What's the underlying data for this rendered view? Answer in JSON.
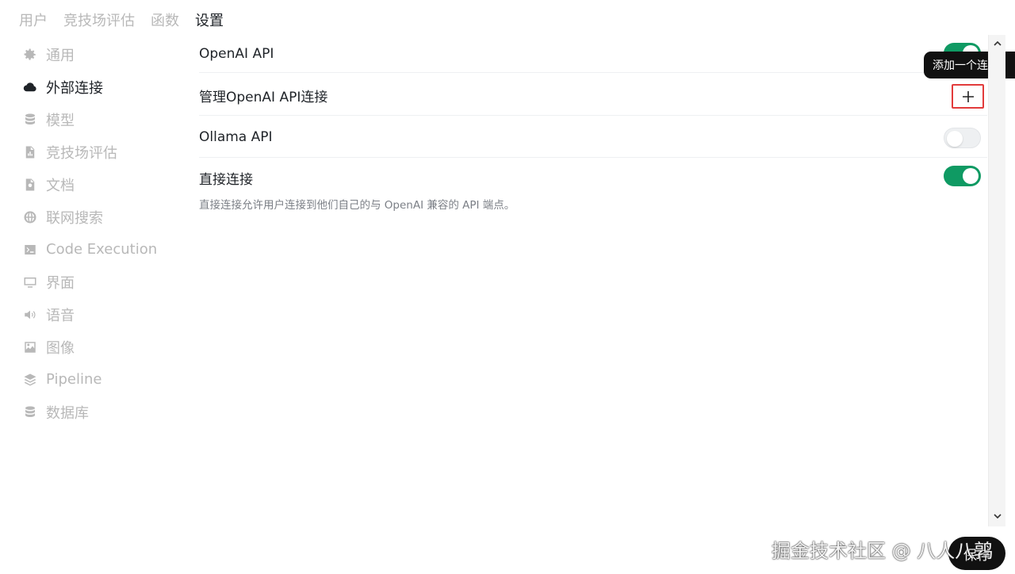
{
  "top_tabs": [
    {
      "label": "用户"
    },
    {
      "label": "竞技场评估"
    },
    {
      "label": "函数"
    },
    {
      "label": "设置"
    }
  ],
  "sidebar": {
    "items": [
      {
        "label": "通用",
        "icon": "gear-icon"
      },
      {
        "label": "外部连接",
        "icon": "cloud-icon"
      },
      {
        "label": "模型",
        "icon": "database-icon"
      },
      {
        "label": "竞技场评估",
        "icon": "document-chart-icon"
      },
      {
        "label": "文档",
        "icon": "document-icon"
      },
      {
        "label": "联网搜索",
        "icon": "globe-icon"
      },
      {
        "label": "Code Execution",
        "icon": "terminal-icon"
      },
      {
        "label": "界面",
        "icon": "monitor-icon"
      },
      {
        "label": "语音",
        "icon": "speaker-icon"
      },
      {
        "label": "图像",
        "icon": "image-icon"
      },
      {
        "label": "Pipeline",
        "icon": "layers-icon"
      },
      {
        "label": "数据库",
        "icon": "database-icon"
      }
    ]
  },
  "settings": {
    "openai_api_label": "OpenAI API",
    "manage_openai_label": "管理OpenAI API连接",
    "ollama_api_label": "Ollama API",
    "direct_connect_label": "直接连接",
    "direct_connect_desc": "直接连接允许用户连接到他们自己的与 OpenAI 兼容的 API 端点。",
    "openai_api_enabled": true,
    "ollama_api_enabled": false,
    "direct_connect_enabled": true
  },
  "tooltip": {
    "text": "添加一个连接"
  },
  "save_label": "保存",
  "watermark": "掘金技术社区 @ 八人八鹑",
  "colors": {
    "toggle_on": "#0f9a63",
    "highlight_border": "#e23b3b"
  }
}
